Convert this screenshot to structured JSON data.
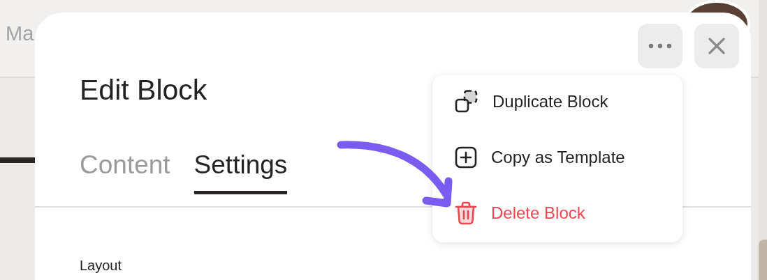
{
  "background": {
    "heading": "Ma"
  },
  "modal": {
    "title": "Edit Block",
    "tabs": [
      {
        "label": "Content",
        "selected": false
      },
      {
        "label": "Settings",
        "selected": true
      }
    ],
    "section_label": "Layout"
  },
  "menu": {
    "items": [
      {
        "label": "Duplicate Block",
        "kind": "duplicate"
      },
      {
        "label": "Copy as Template",
        "kind": "template"
      },
      {
        "label": "Delete Block",
        "kind": "delete"
      }
    ]
  }
}
